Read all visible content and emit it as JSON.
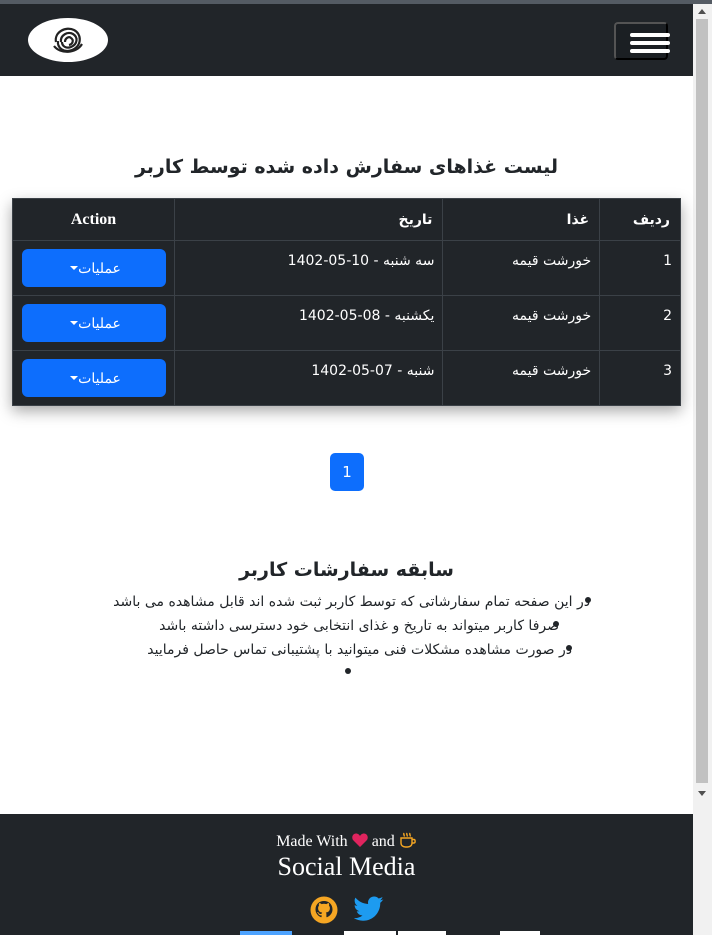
{
  "navbar": {
    "logo_icon": "swirl-logo-icon",
    "menu_icon": "hamburger-menu-icon"
  },
  "page": {
    "title": "لیست غذاهای سفارش داده شده توسط کاربر"
  },
  "table": {
    "headers": {
      "row": "ردیف",
      "food": "غذا",
      "date": "تاریخ",
      "action": "Action"
    },
    "rows": [
      {
        "row": "1",
        "food": "خورشت قیمه",
        "date": "سه شنبه - 10-05-1402",
        "action_label": "عملیات"
      },
      {
        "row": "2",
        "food": "خورشت قیمه",
        "date": "یکشنبه - 08-05-1402",
        "action_label": "عملیات"
      },
      {
        "row": "3",
        "food": "خورشت قیمه",
        "date": "شنبه - 07-05-1402",
        "action_label": "عملیات"
      }
    ]
  },
  "pagination": {
    "current": "1"
  },
  "history": {
    "title": "سابقه سفارشات کاربر",
    "items": [
      "در این صفحه تمام سفارشاتی که توسط کاربر ثبت شده اند قابل مشاهده می باشد",
      "صرفا کاربر میتواند به تاریخ و غذای انتخابی خود دسترسی داشته باشد",
      "در صورت مشاهده مشکلات فنی میتوانید با پشتیبانی تماس حاصل فرمایید"
    ]
  },
  "footer": {
    "made_with": "Made With",
    "and": "and",
    "social_title": "Social Media",
    "heart_color": "#e0245e",
    "coffee_color": "#f5a623",
    "github_color": "#f5a623",
    "twitter_color": "#1d9bf0"
  },
  "colors": {
    "navbar_bg": "#212529",
    "primary": "#0d6efd"
  }
}
